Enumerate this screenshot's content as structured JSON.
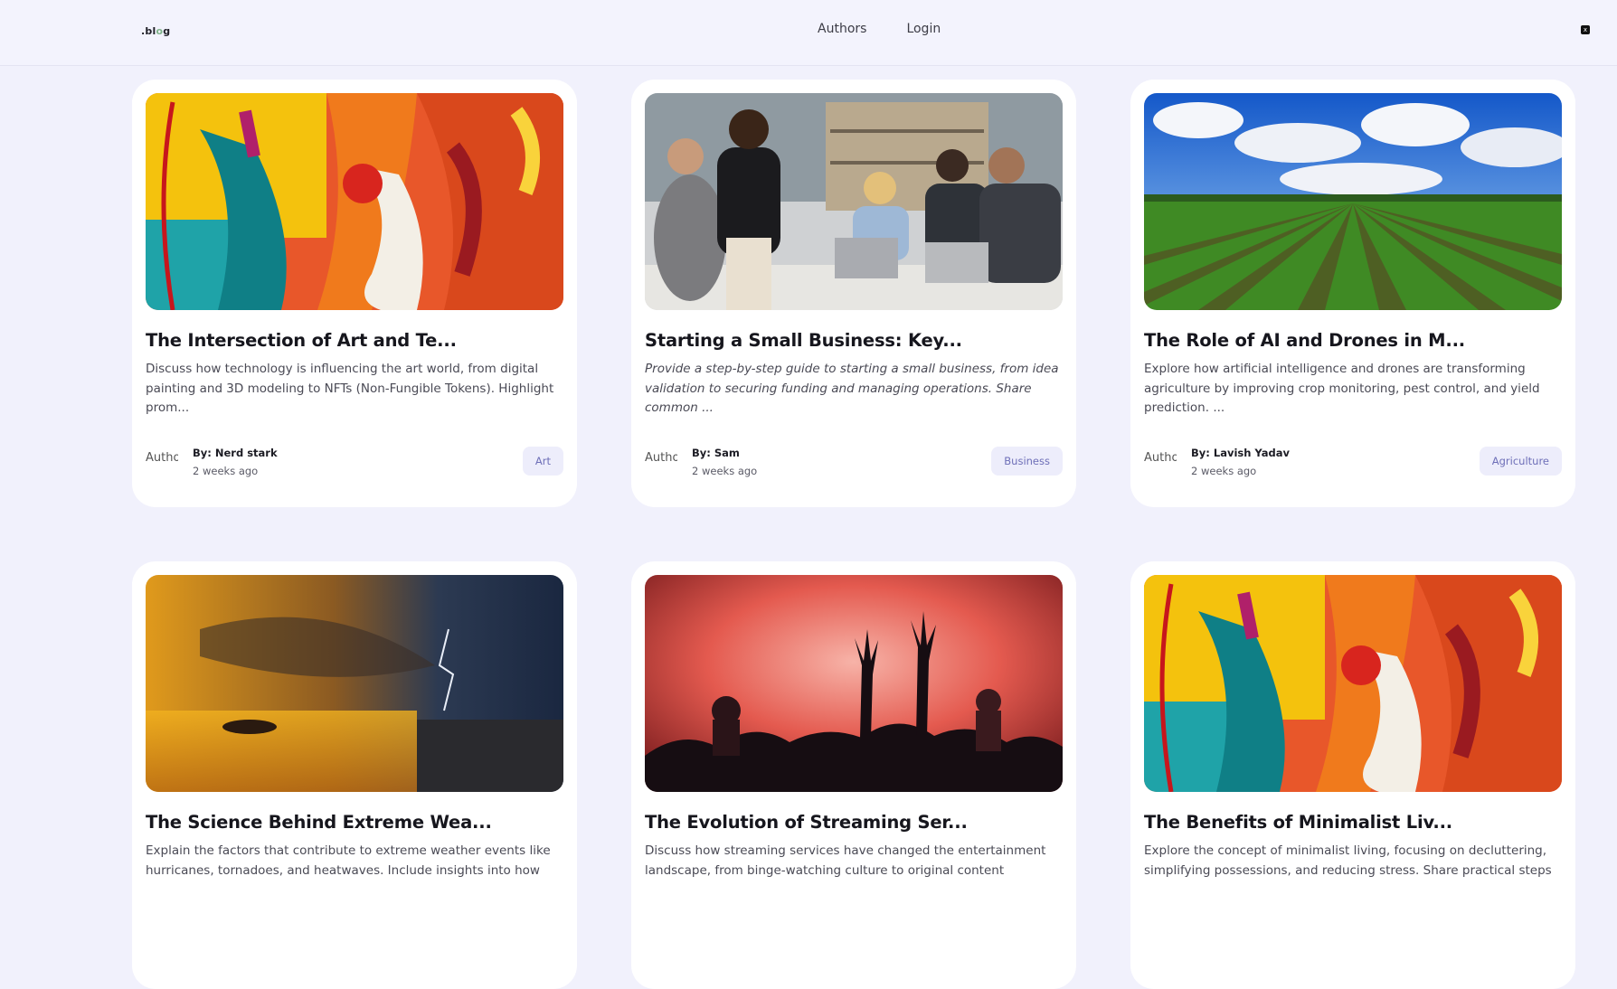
{
  "header": {
    "logo_prefix": ".bl",
    "logo_dot": "o",
    "logo_suffix": "g",
    "nav": [
      {
        "label": "Authors"
      },
      {
        "label": "Login"
      }
    ],
    "theme_toggle": "x"
  },
  "posts": [
    {
      "title": "The Intersection of Art and Te...",
      "description": " Discuss how technology is influencing the art world, from digital painting and 3D modeling to NFTs (Non-Fungible Tokens). Highlight prom...",
      "avatar_alt": "Author",
      "author": "By: Nerd stark",
      "time": "2 weeks ago",
      "tag": "Art",
      "image": "abstract-painting"
    },
    {
      "title": "Starting a Small Business: Key...",
      "description": "Provide a step-by-step guide to starting a small business, from idea validation to securing funding and managing operations. Share common ...",
      "avatar_alt": "Author",
      "author": "By: Sam",
      "time": "2 weeks ago",
      "tag": "Business",
      "image": "business-meeting"
    },
    {
      "title": "The Role of AI and Drones in M...",
      "description": "Explore how artificial intelligence and drones are transforming agriculture by improving crop monitoring, pest control, and yield prediction. ...",
      "avatar_alt": "Author",
      "author": "By: Lavish Yadav",
      "time": "2 weeks ago",
      "tag": "Agriculture",
      "image": "crop-field"
    },
    {
      "title": "The Science Behind Extreme Wea...",
      "description": "Explain the factors that contribute to extreme weather events like hurricanes, tornadoes, and heatwaves. Include insights into how",
      "image": "storm-sunset"
    },
    {
      "title": "The Evolution of Streaming Ser...",
      "description": " Discuss how streaming services have changed the entertainment landscape, from binge-watching culture to original content",
      "image": "concert-crowd"
    },
    {
      "title": "The Benefits of Minimalist Liv...",
      "description": "Explore the concept of minimalist living, focusing on decluttering, simplifying possessions, and reducing stress. Share practical steps",
      "image": "abstract-painting"
    }
  ]
}
